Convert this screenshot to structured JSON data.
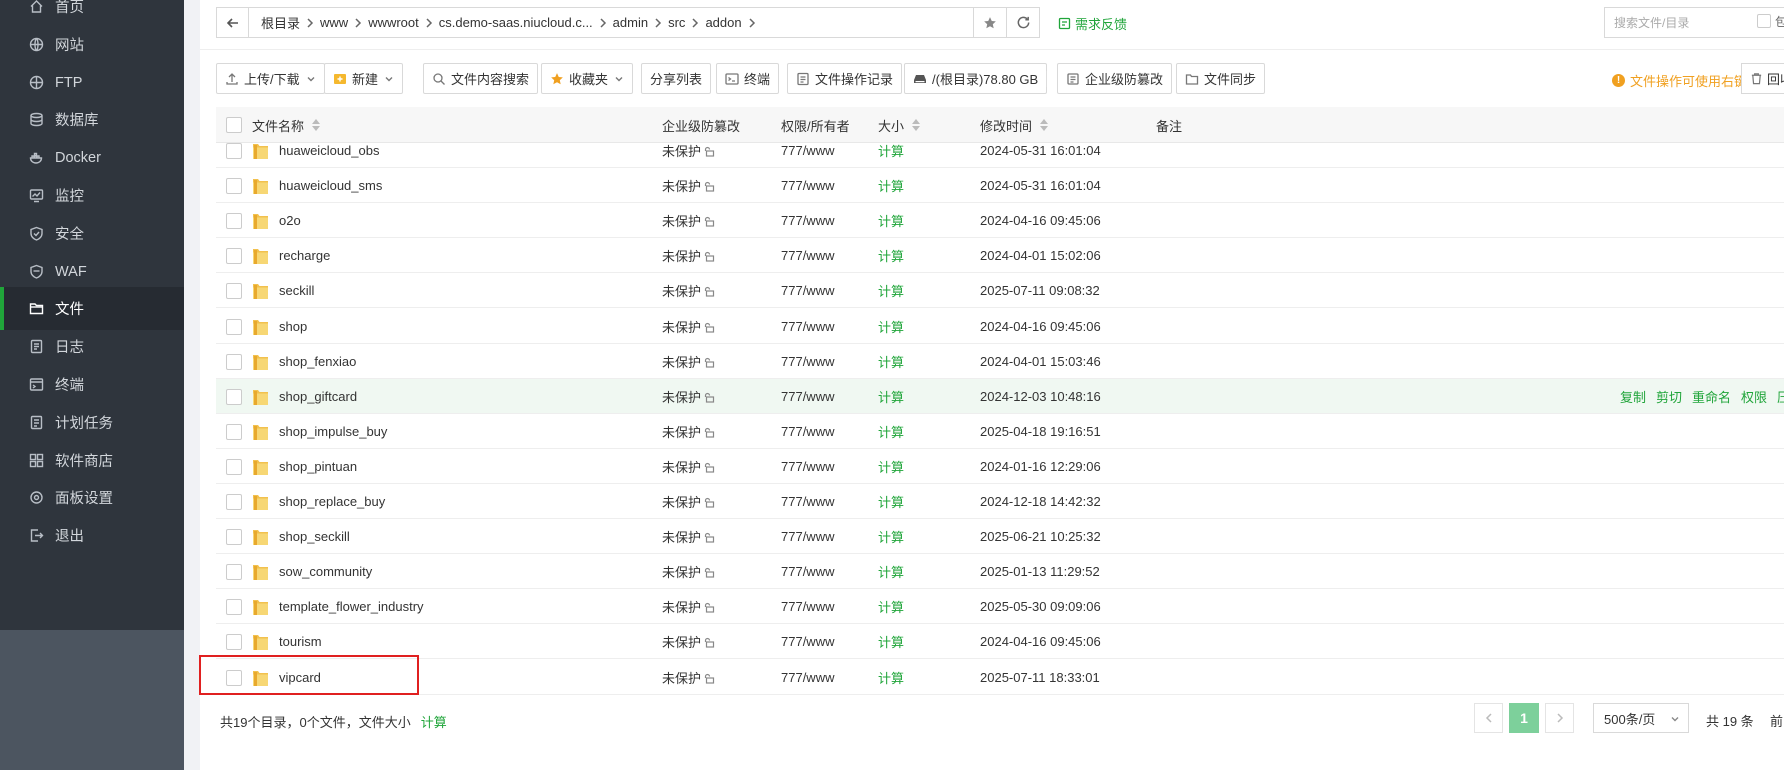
{
  "sidebar": {
    "items": [
      {
        "label": "首页",
        "icon": "home-icon"
      },
      {
        "label": "网站",
        "icon": "globe-icon"
      },
      {
        "label": "FTP",
        "icon": "ftp-icon"
      },
      {
        "label": "数据库",
        "icon": "database-icon"
      },
      {
        "label": "Docker",
        "icon": "docker-icon"
      },
      {
        "label": "监控",
        "icon": "monitor-icon"
      },
      {
        "label": "安全",
        "icon": "shield-icon"
      },
      {
        "label": "WAF",
        "icon": "waf-icon"
      },
      {
        "label": "文件",
        "icon": "folder-icon",
        "active": true
      },
      {
        "label": "日志",
        "icon": "log-icon"
      },
      {
        "label": "终端",
        "icon": "terminal-icon"
      },
      {
        "label": "计划任务",
        "icon": "task-icon"
      },
      {
        "label": "软件商店",
        "icon": "store-icon"
      },
      {
        "label": "面板设置",
        "icon": "settings-icon"
      },
      {
        "label": "退出",
        "icon": "logout-icon"
      }
    ]
  },
  "address": {
    "crumbs": [
      "根目录",
      "www",
      "wwwroot",
      "cs.demo-saas.niucloud.c...",
      "admin",
      "src",
      "addon"
    ]
  },
  "header": {
    "feedback": "需求反馈",
    "search_placeholder": "搜索文件/目录",
    "search_extra": "包"
  },
  "toolbar": {
    "upload": "上传/下载",
    "new": "新建",
    "content_search": "文件内容搜索",
    "favorites": "收藏夹",
    "share_list": "分享列表",
    "terminal": "终端",
    "op_log": "文件操作记录",
    "disk": "/(根目录)78.80 GB",
    "tamper": "企业级防篡改",
    "sync": "文件同步",
    "tip": "文件操作可使用右键",
    "recycle": "回收"
  },
  "table": {
    "headers": {
      "name": "文件名称",
      "tamper": "企业级防篡改",
      "perm": "权限/所有者",
      "size": "大小",
      "mtime": "修改时间",
      "note": "备注"
    },
    "rows": [
      {
        "name": "huaweicloud_obs",
        "tamper": "未保护",
        "perm": "777/www",
        "size": "计算",
        "mtime": "2024-05-31 16:01:04"
      },
      {
        "name": "huaweicloud_sms",
        "tamper": "未保护",
        "perm": "777/www",
        "size": "计算",
        "mtime": "2024-05-31 16:01:04"
      },
      {
        "name": "o2o",
        "tamper": "未保护",
        "perm": "777/www",
        "size": "计算",
        "mtime": "2024-04-16 09:45:06"
      },
      {
        "name": "recharge",
        "tamper": "未保护",
        "perm": "777/www",
        "size": "计算",
        "mtime": "2024-04-01 15:02:06"
      },
      {
        "name": "seckill",
        "tamper": "未保护",
        "perm": "777/www",
        "size": "计算",
        "mtime": "2025-07-11 09:08:32"
      },
      {
        "name": "shop",
        "tamper": "未保护",
        "perm": "777/www",
        "size": "计算",
        "mtime": "2024-04-16 09:45:06"
      },
      {
        "name": "shop_fenxiao",
        "tamper": "未保护",
        "perm": "777/www",
        "size": "计算",
        "mtime": "2024-04-01 15:03:46"
      },
      {
        "name": "shop_giftcard",
        "tamper": "未保护",
        "perm": "777/www",
        "size": "计算",
        "mtime": "2024-12-03 10:48:16"
      },
      {
        "name": "shop_impulse_buy",
        "tamper": "未保护",
        "perm": "777/www",
        "size": "计算",
        "mtime": "2025-04-18 19:16:51"
      },
      {
        "name": "shop_pintuan",
        "tamper": "未保护",
        "perm": "777/www",
        "size": "计算",
        "mtime": "2024-01-16 12:29:06"
      },
      {
        "name": "shop_replace_buy",
        "tamper": "未保护",
        "perm": "777/www",
        "size": "计算",
        "mtime": "2024-12-18 14:42:32"
      },
      {
        "name": "shop_seckill",
        "tamper": "未保护",
        "perm": "777/www",
        "size": "计算",
        "mtime": "2025-06-21 10:25:32"
      },
      {
        "name": "sow_community",
        "tamper": "未保护",
        "perm": "777/www",
        "size": "计算",
        "mtime": "2025-01-13 11:29:52"
      },
      {
        "name": "template_flower_industry",
        "tamper": "未保护",
        "perm": "777/www",
        "size": "计算",
        "mtime": "2025-05-30 09:09:06"
      },
      {
        "name": "tourism",
        "tamper": "未保护",
        "perm": "777/www",
        "size": "计算",
        "mtime": "2024-04-16 09:45:06"
      },
      {
        "name": "vipcard",
        "tamper": "未保护",
        "perm": "777/www",
        "size": "计算",
        "mtime": "2025-07-11 18:33:01"
      }
    ],
    "hover_actions": [
      "复制",
      "剪切",
      "重命名",
      "权限",
      "压缩"
    ]
  },
  "footer": {
    "summary": "共19个目录，0个文件，文件大小",
    "calc": "计算",
    "page": "1",
    "per_page": "500条/页",
    "total": "共 19 条",
    "front": "前"
  },
  "colors": {
    "accent": "#20a53a",
    "sidebar_bg": "#2f353d",
    "warning": "#f0a020",
    "highlight": "#e02020"
  }
}
